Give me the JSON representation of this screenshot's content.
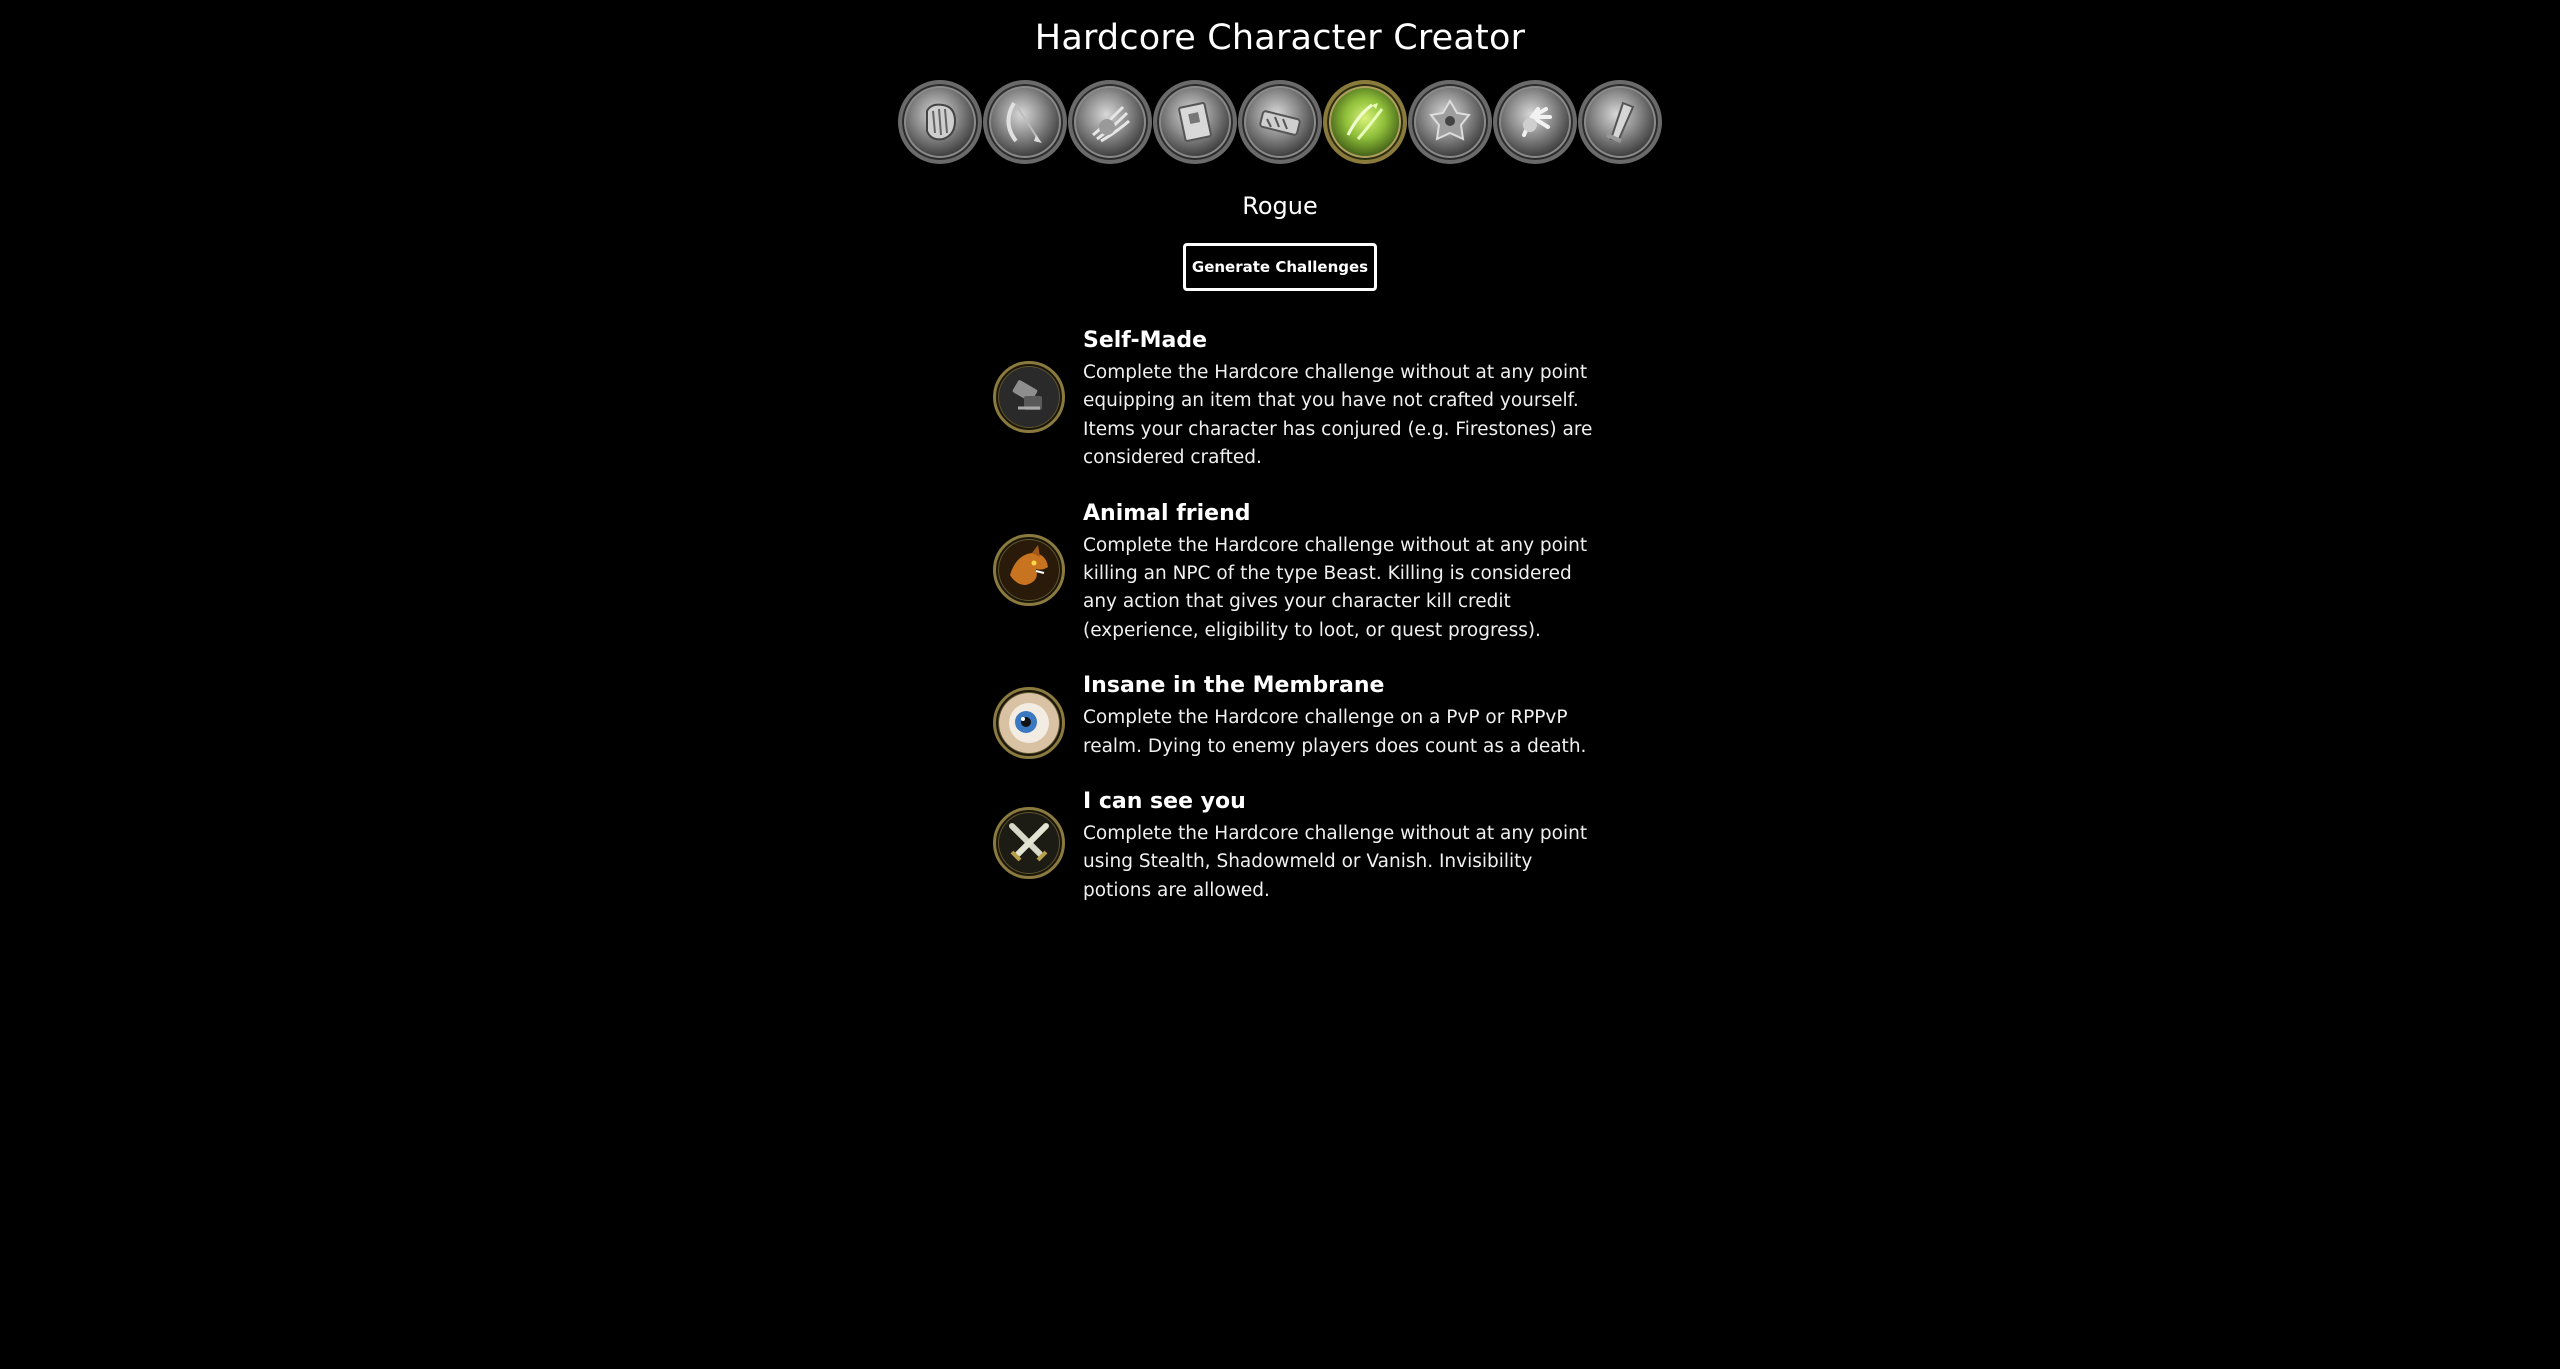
{
  "app": {
    "title": "Hardcore Character Creator"
  },
  "class_selector": {
    "classes": [
      {
        "icon": "warrior-fist-icon",
        "selected": false
      },
      {
        "icon": "hunter-bow-icon",
        "selected": false
      },
      {
        "icon": "druid-claw-icon",
        "selected": false
      },
      {
        "icon": "priest-book-icon",
        "selected": false
      },
      {
        "icon": "warlock-hand-icon",
        "selected": false
      },
      {
        "icon": "rogue-blades-icon",
        "selected": true
      },
      {
        "icon": "shaman-totem-icon",
        "selected": false
      },
      {
        "icon": "mage-hand-icon",
        "selected": false
      },
      {
        "icon": "paladin-hammer-icon",
        "selected": false
      }
    ],
    "selected_name": "Rogue"
  },
  "actions": {
    "generate_label": "Generate Challenges"
  },
  "challenges": [
    {
      "title": "Self-Made",
      "description": "Complete the Hardcore challenge without at any point equipping an item that you have not crafted yourself. Items your character has conjured (e.g. Firestones) are considered crafted.",
      "icon": "crafting-anvil-icon"
    },
    {
      "title": "Animal friend",
      "description": "Complete the Hardcore challenge without at any point killing an NPC of the type Beast. Killing is considered any action that gives your character kill credit (experience, eligibility to loot, or quest progress).",
      "icon": "beast-head-icon"
    },
    {
      "title": "Insane in the Membrane",
      "description": "Complete the Hardcore challenge on a PvP or RPPvP realm. Dying to enemy players does count as a death.",
      "icon": "eye-icon"
    },
    {
      "title": "I can see you",
      "description": "Complete the Hardcore challenge without at any point using Stealth, Shadowmeld or Vanish. Invisibility potions are allowed.",
      "icon": "crossed-daggers-icon"
    }
  ],
  "colors": {
    "background": "#000000",
    "text": "#ffffff",
    "selected_ring": "#8a7a3c",
    "ring": "#6a6a6a"
  }
}
